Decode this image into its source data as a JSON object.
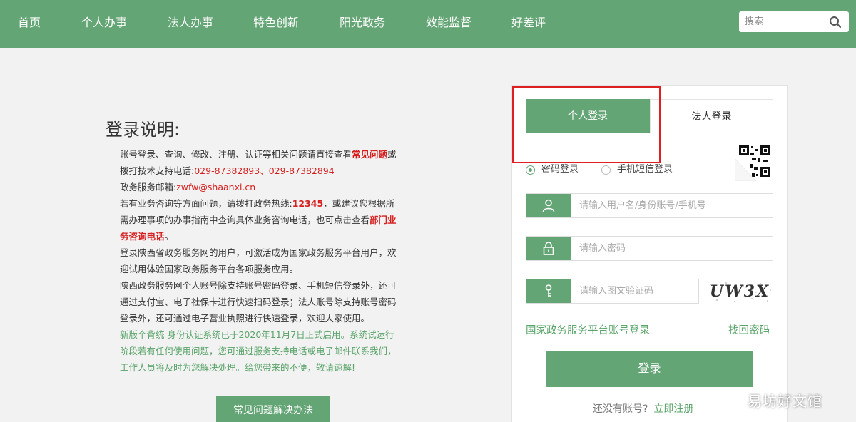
{
  "nav": {
    "items": [
      {
        "label": "首页"
      },
      {
        "label": "个人办事"
      },
      {
        "label": "法人办事"
      },
      {
        "label": "特色创新"
      },
      {
        "label": "阳光政务"
      },
      {
        "label": "效能监督"
      },
      {
        "label": "好差评"
      }
    ],
    "search_placeholder": "搜索",
    "search_icon": "search-icon"
  },
  "info": {
    "title": "登录说明:",
    "l1_a": "账号登录、查询、修改、注册、认证等相关问题请直接查看",
    "l1_b": "常见问题",
    "l1_c": "或",
    "l2_a": "拨打技术支持电话:",
    "l2_b": "029-87382893、029-87382894",
    "l3_a": "政务服务邮箱:",
    "l3_b": "zwfw@shaanxi.cn",
    "l4_a": "若有业务咨询等方面问题，请拨打政务热线:",
    "l4_b": "12345",
    "l4_c": "，或建议您根据所",
    "l5_a": "需办理事项的办事指南中查询具体业务咨询电话，也可点击查看",
    "l5_b": "部门业",
    "l6": "务咨询电话",
    "l6_tail": "。",
    "l7": "登录陕西省政务服务网的用户，可激活成为国家政务服务平台用户，欢",
    "l8": "迎试用体验国家政务服务平台各项服务应用。",
    "l9": "陕西政务服务网个人账号除支持账号密码登录、手机短信登录外，还可",
    "l10": "通过支付宝、电子社保卡进行快速扫码登录；法人账号除支持账号密码",
    "l11": "登录外，还可通过电子营业执照进行快速登录，欢迎大家使用。",
    "g1": "新版个背统    身份认证系统已于2020年11月7日正式启用。系统试运行",
    "g2": "阶段若有任何使用问题，您可通过服务支持电话或电子邮件联系我们，",
    "g3": "工作人员将及时为您解决处理。给您带来的不便，敬请谅解!",
    "faq_button": "常见问题解决办法"
  },
  "login": {
    "tab_personal": "个人登录",
    "tab_legal": "法人登录",
    "radio_password": "密码登录",
    "radio_sms": "手机短信登录",
    "username_placeholder": "请输入用户名/身份账号/手机号",
    "password_placeholder": "请输入密码",
    "captcha_placeholder": "请输入图文验证码",
    "captcha_text": "UW3X",
    "national_link": "国家政务服务平台账号登录",
    "forgot_link": "找回密码",
    "login_button": "登录",
    "register_prompt": "还没有账号?",
    "register_link": "立即注册"
  },
  "watermark": "易坊好文馆",
  "colors": {
    "primary": "#64a575",
    "highlight": "#e02020",
    "alert": "#d62020"
  }
}
